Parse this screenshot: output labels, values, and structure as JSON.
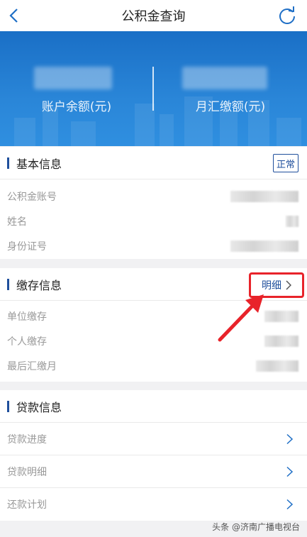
{
  "navbar": {
    "title": "公积金查询",
    "back_icon": "chevron-left-icon",
    "refresh_icon": "refresh-icon"
  },
  "hero": {
    "balance_label": "账户余额(元)",
    "monthly_label": "月汇缴额(元)"
  },
  "basic_info": {
    "title": "基本信息",
    "status_badge": "正常",
    "rows": [
      {
        "label": "公积金账号"
      },
      {
        "label": "姓名"
      },
      {
        "label": "身份证号"
      }
    ]
  },
  "deposit_info": {
    "title": "缴存信息",
    "detail_label": "明细",
    "rows": [
      {
        "label": "单位缴存"
      },
      {
        "label": "个人缴存"
      },
      {
        "label": "最后汇缴月"
      }
    ]
  },
  "loan_info": {
    "title": "贷款信息",
    "rows": [
      {
        "label": "贷款进度"
      },
      {
        "label": "贷款明细"
      },
      {
        "label": "还款计划"
      }
    ]
  },
  "watermark": "头条 @济南广播电视台",
  "colors": {
    "accent_blue": "#1f4f9c",
    "hero_blue": "#2a86d8",
    "highlight_red": "#e8232a"
  }
}
